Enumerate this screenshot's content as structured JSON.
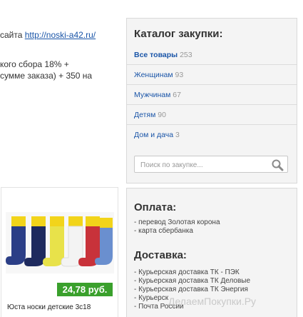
{
  "left": {
    "site_prefix": "сайта ",
    "site_link": "http://noski-a42.ru/",
    "info_line1": "кого сбора 18% +",
    "info_line2": "сумме заказа) + 350 на"
  },
  "product": {
    "price": "24,78 руб.",
    "name": "Юста носки детские 3с18"
  },
  "catalog": {
    "title": "Каталог закупки:",
    "items": [
      {
        "label": "Все товары",
        "count": "253"
      },
      {
        "label": "Женщинам",
        "count": "93"
      },
      {
        "label": "Мужчинам",
        "count": "67"
      },
      {
        "label": "Детям",
        "count": "90"
      },
      {
        "label": "Дом и дача",
        "count": "3"
      }
    ],
    "search_placeholder": "Поиск по закупке..."
  },
  "payment": {
    "title": "Оплата:",
    "items": [
      "- перевод Золотая корона",
      "- карта сбербанка"
    ]
  },
  "delivery": {
    "title": "Доставка:",
    "items": [
      "- Курьерская доставка ТК - ПЭК",
      "- Курьерская доставка ТК Деловые",
      "- Курьерская доставка ТК Энергия",
      "- Курьерск",
      "- Почта России"
    ]
  },
  "watermark": "ДелаемПокупки.Ру",
  "colors": {
    "link": "#1a55a8",
    "price_bg": "#3aa02c",
    "panel_bg": "#f4f4f4"
  }
}
